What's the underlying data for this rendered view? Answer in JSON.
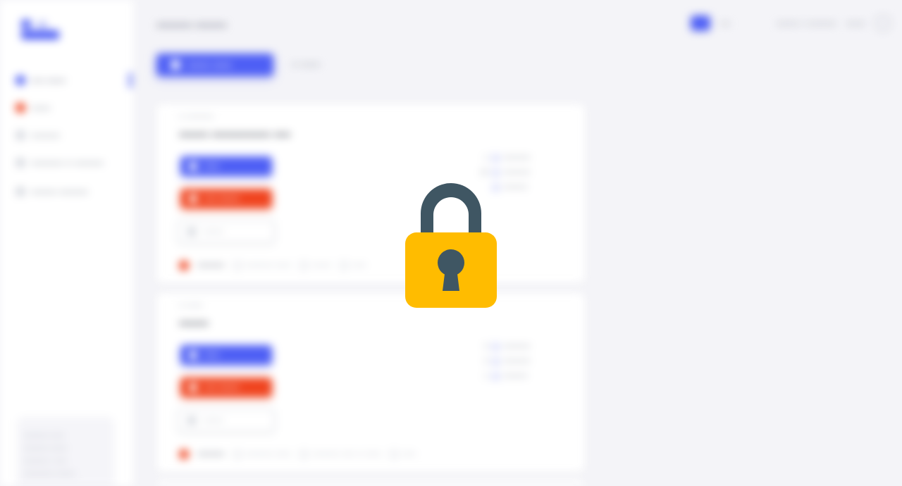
{
  "app": {
    "lock_icon": "lock-icon",
    "colors": {
      "accent": "#4e5ff5",
      "danger": "#f0441f",
      "lock_body": "#ffbc00",
      "lock_shackle": "#3f5663",
      "background": "#f4f4f8"
    }
  },
  "sidebar": {
    "logo": "app-logo",
    "items": [
      {
        "label": "•••• ••••••",
        "icon": "home-icon",
        "color": "#4e5ff5"
      },
      {
        "label": "••••••",
        "icon": "fire-icon",
        "color": "#f0441f"
      },
      {
        "label": "•••••••••",
        "icon": "chart-icon",
        "color": "#c9ccd4"
      },
      {
        "label": "•••••••••• •• •••••••••",
        "icon": "clock-icon",
        "color": "#c9ccd4"
      },
      {
        "label": "•••••••• •••••••••",
        "icon": "wrench-icon",
        "color": "#c9ccd4"
      }
    ],
    "footer_lines": [
      "••••••••• •••••",
      "••••••••• ••••••",
      "••••••••• • ••••",
      "••••••••••• •••••••"
    ]
  },
  "header": {
    "title": "••••••••• ••••••••",
    "lang_label": "•••",
    "account_label": "••••••• • •••••••••",
    "logout_label": "••••••"
  },
  "toolbar": {
    "create_label": "••••••• ••••••",
    "secondary_label": "•• ••••••"
  },
  "cards": [
    {
      "meta": "•• ••••••••••",
      "title": "••••••• •••••••••••••• ••••",
      "primary_label": "•••••",
      "danger_label": "•••• •••••••",
      "outline_label": "•••••••",
      "stats": [
        {
          "num": "1",
          "label": "••••••••••"
        },
        {
          "num": "18",
          "label": "••••••••••"
        },
        {
          "num": "",
          "label": "•••••••••"
        }
      ],
      "footer_label": "••••••••••",
      "footer_items": [
        "•••••••••• ••••••",
        "•••••••",
        "•••••"
      ]
    },
    {
      "meta": "•• ••••••",
      "title": "•••••••",
      "primary_label": "•••••",
      "danger_label": "•••• •••••••",
      "outline_label": "•••••••",
      "stats": [
        {
          "num": "0",
          "label": "••••••••••"
        },
        {
          "num": "0",
          "label": "••••••••••"
        },
        {
          "num": "1",
          "label": "•••••••••"
        }
      ],
      "footer_label": "••••••••••",
      "footer_items": [
        "•••••••••• ••••••",
        "•••••••••• ••••• •• ••••••",
        "•••••"
      ]
    }
  ]
}
